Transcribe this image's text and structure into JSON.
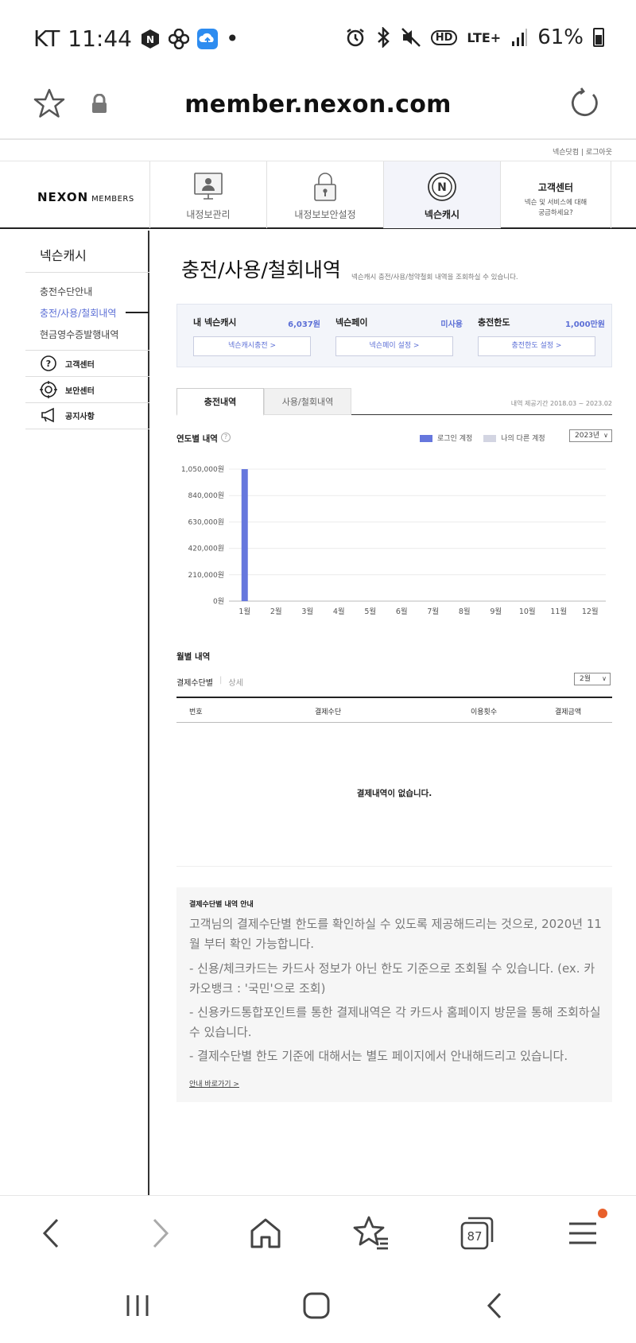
{
  "status_bar": {
    "carrier": "KT",
    "time": "11:44",
    "dot": "•",
    "network": "LTE+",
    "hd_label": "HD",
    "battery_percent": "61%",
    "icons": [
      "nexon-app-icon",
      "pinwheel-icon",
      "cloud-app-icon",
      "alarm-icon",
      "bluetooth-icon",
      "mute-icon",
      "hd-voice-icon",
      "signal-icon",
      "battery-icon"
    ]
  },
  "browser": {
    "url": "member.nexon.com",
    "toolbar_icons": [
      "back-icon",
      "forward-icon",
      "home-icon",
      "bookmarks-icon",
      "tabs-icon",
      "menu-icon"
    ],
    "tab_count": "87"
  },
  "util_links": "넥슨닷컴 | 로그아웃",
  "logo": {
    "brand": "NEXON",
    "suffix": "MEMBERS"
  },
  "top_nav": {
    "tabs": [
      {
        "label": "내정보관리",
        "icon": "monitor-user-icon"
      },
      {
        "label": "내정보보안설정",
        "icon": "padlock-icon"
      },
      {
        "label": "넥슨캐시",
        "icon": "nexon-coin-icon"
      }
    ],
    "customer_center": {
      "title": "고객센터",
      "line1": "넥슨 및 서비스에 대해",
      "line2": "궁금하세요?"
    }
  },
  "sidebar": {
    "title": "넥슨캐시",
    "links": [
      "충전수단안내",
      "충전/사용/철회내역",
      "현금영수증발행내역"
    ],
    "tools": [
      {
        "label": "고객센터",
        "icon": "question-circle-icon"
      },
      {
        "label": "보안센터",
        "icon": "target-circle-icon"
      },
      {
        "label": "공지사항",
        "icon": "megaphone-icon"
      }
    ]
  },
  "main": {
    "title": "충전/사용/철회내역",
    "description": "넥슨캐시 충전/사용/청약철회 내역을 조회하실 수 있습니다.",
    "summary": [
      {
        "label": "내 넥슨캐시",
        "value": "6,037원",
        "button": "넥슨캐시충전 >"
      },
      {
        "label": "넥슨페이",
        "value": "미사용",
        "button": "넥슨페이 설정 >"
      },
      {
        "label": "충전한도",
        "value": "1,000만원",
        "button": "충전한도 설정 >"
      }
    ],
    "tabs": [
      "충전내역",
      "사용/철회내역"
    ],
    "tabs_note": "내역 제공기간 2018.03 ~ 2023.02",
    "yearly": {
      "title": "연도별 내역",
      "help": "?",
      "legend": [
        "로그인 계정",
        "나의 다른 계정"
      ],
      "year_select": "2023년",
      "caret": "∨"
    },
    "monthly": {
      "title": "월별 내역",
      "subtabs": [
        "결제수단별",
        "상세"
      ],
      "subtab_sep": "|",
      "month_select": "2월",
      "caret": "∨",
      "columns": [
        "번호",
        "결제수단",
        "이용횟수",
        "결제금액"
      ],
      "empty": "결제내역이 없습니다."
    },
    "notice": {
      "title": "결제수단별 내역 안내",
      "p1": "고객님의 결제수단별 한도를 확인하실 수 있도록 제공해드리는 것으로, 2020년 11월 부터 확인 가능합니다.",
      "p2": "- 신용/체크카드는 카드사 정보가 아닌 한도 기준으로 조회될 수 있습니다. (ex. 카카오뱅크 : '국민'으로 조회)",
      "p3": "- 신용카드통합포인트를 통한 결제내역은 각 카드사 홈페이지 방문을 통해 조회하실 수 있습니다.",
      "p4": "- 결제수단별 한도 기준에 대해서는 별도 페이지에서 안내해드리고 있습니다.",
      "link": "안내 바로가기 >"
    }
  },
  "chart_data": {
    "type": "bar",
    "categories": [
      "1월",
      "2월",
      "3월",
      "4월",
      "5월",
      "6월",
      "7월",
      "8월",
      "9월",
      "10월",
      "11월",
      "12월"
    ],
    "series": [
      {
        "name": "로그인 계정",
        "values": [
          1050000,
          0,
          0,
          0,
          0,
          0,
          0,
          0,
          0,
          0,
          0,
          0
        ]
      }
    ],
    "yticks": [
      "0원",
      "210,000원",
      "420,000원",
      "630,000원",
      "840,000원",
      "1,050,000원"
    ],
    "ylim": [
      0,
      1050000
    ],
    "grid": true,
    "legend": "top-right",
    "bar_color": "#6677dd"
  },
  "colors": {
    "accent": "#5c6fd6",
    "bar": "#6677dd",
    "other_account": "#d3d5e2",
    "notification_dot": "#e8602c"
  }
}
